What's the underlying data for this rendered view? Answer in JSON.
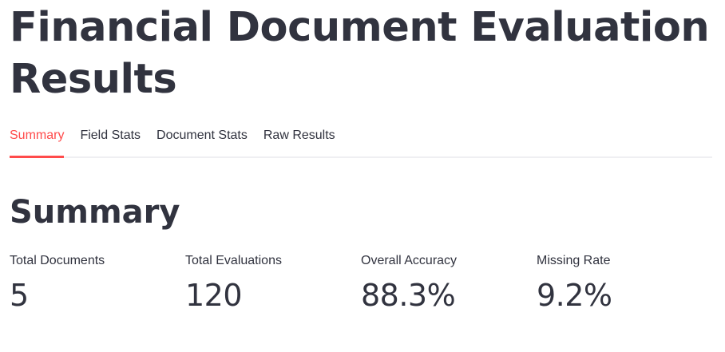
{
  "header": {
    "title": "Financial Document Evaluation Results"
  },
  "tabs": [
    {
      "label": "Summary",
      "active": true
    },
    {
      "label": "Field Stats",
      "active": false
    },
    {
      "label": "Document Stats",
      "active": false
    },
    {
      "label": "Raw Results",
      "active": false
    }
  ],
  "summary": {
    "title": "Summary",
    "metrics": [
      {
        "label": "Total Documents",
        "value": "5"
      },
      {
        "label": "Total Evaluations",
        "value": "120"
      },
      {
        "label": "Overall Accuracy",
        "value": "88.3%"
      },
      {
        "label": "Missing Rate",
        "value": "9.2%"
      }
    ]
  },
  "colors": {
    "accent": "#ff4b4b",
    "text": "#31333f",
    "tab_border": "#efeff2"
  }
}
